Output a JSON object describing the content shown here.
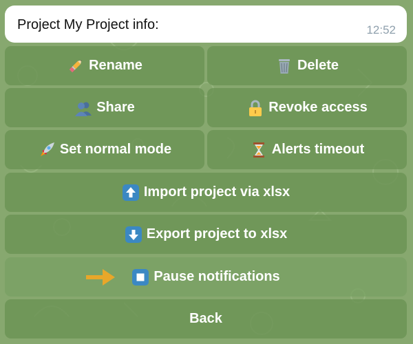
{
  "message": {
    "text": "Project My Project info:",
    "time": "12:52"
  },
  "keyboard": {
    "rename": {
      "label": "Rename",
      "icon": "pencil-icon"
    },
    "delete": {
      "label": "Delete",
      "icon": "wastebasket-icon"
    },
    "share": {
      "label": "Share",
      "icon": "people-icon"
    },
    "revoke_access": {
      "label": "Revoke access",
      "icon": "lock-icon"
    },
    "set_normal_mode": {
      "label": "Set normal mode",
      "icon": "rocket-icon"
    },
    "alerts_timeout": {
      "label": "Alerts timeout",
      "icon": "hourglass-icon"
    },
    "import_project": {
      "label": "Import project via xlsx",
      "icon": "up-arrow-icon"
    },
    "export_project": {
      "label": "Export project to xlsx",
      "icon": "down-arrow-icon"
    },
    "pause_notifications": {
      "label": "Pause notifications",
      "icon": "stop-button-icon"
    },
    "back": {
      "label": "Back"
    }
  },
  "colors": {
    "background": "#87a86f",
    "button": "#6a9254",
    "emoji_key_blue": "#3b88c3",
    "pointer_arrow": "#e8a72a"
  }
}
